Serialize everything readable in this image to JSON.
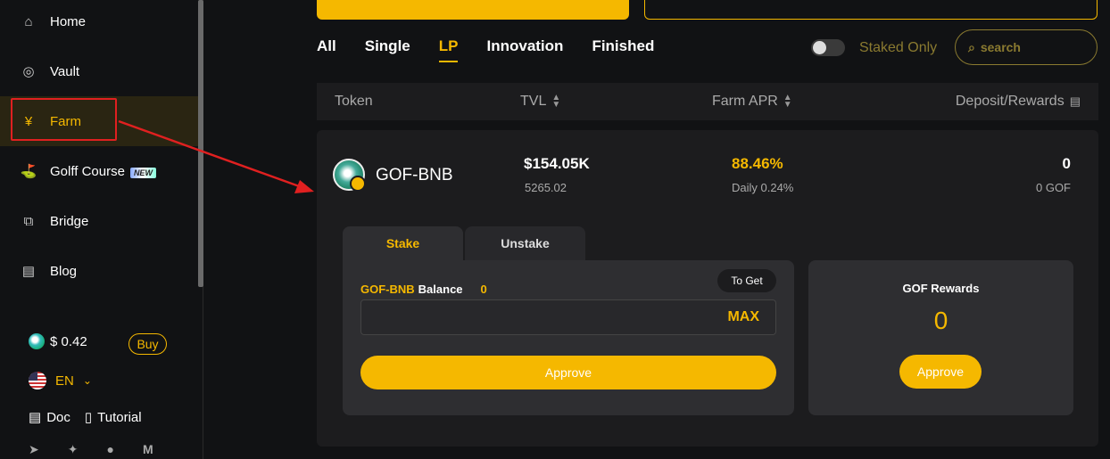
{
  "sidebar": {
    "items": [
      {
        "label": "Home",
        "icon": "home-icon"
      },
      {
        "label": "Vault",
        "icon": "vault-icon"
      },
      {
        "label": "Farm",
        "icon": "farm-icon"
      },
      {
        "label": "Golff Course",
        "icon": "golf-icon",
        "badge": "NEW"
      },
      {
        "label": "Bridge",
        "icon": "bridge-icon"
      },
      {
        "label": "Blog",
        "icon": "blog-icon"
      }
    ],
    "price": "$ 0.42",
    "buy_label": "Buy",
    "language": "EN",
    "doc_label": "Doc",
    "tutorial_label": "Tutorial"
  },
  "filters": {
    "tabs": [
      "All",
      "Single",
      "LP",
      "Innovation",
      "Finished"
    ],
    "active_tab": "LP",
    "staked_only_label": "Staked Only",
    "search_placeholder": "search"
  },
  "table": {
    "headers": {
      "token": "Token",
      "tvl": "TVL",
      "apr": "Farm APR",
      "deposit": "Deposit/Rewards"
    }
  },
  "farm": {
    "token": "GOF-BNB",
    "tvl": "$154.05K",
    "tvl_sub": "5265.02",
    "apr": "88.46%",
    "apr_daily": "Daily 0.24%",
    "deposit": "0",
    "deposit_sub": "0 GOF",
    "stake_tab": "Stake",
    "unstake_tab": "Unstake",
    "balance_token": "GOF-BNB",
    "balance_label": "Balance",
    "balance_value": "0",
    "to_get_label": "To Get",
    "max_label": "MAX",
    "approve_label": "Approve",
    "rewards_title": "GOF Rewards",
    "rewards_value": "0",
    "rewards_approve_label": "Approve"
  },
  "colors": {
    "accent": "#f5b800",
    "annotation": "#e02020"
  }
}
